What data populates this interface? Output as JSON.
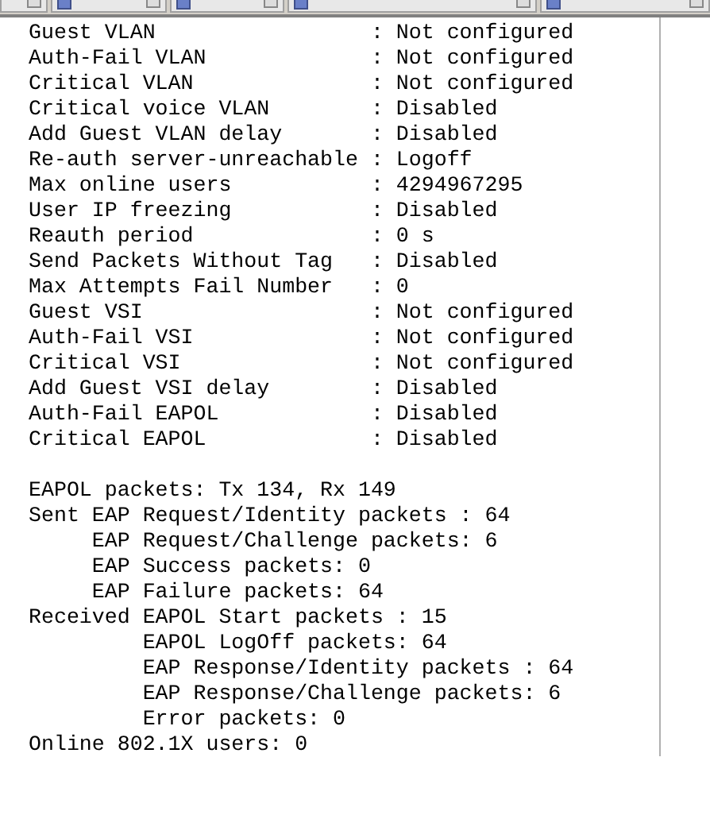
{
  "tabs": [
    {
      "selected": false
    },
    {
      "selected": false
    },
    {
      "selected": false
    },
    {
      "selected": false
    },
    {
      "selected": false
    }
  ],
  "sections": [
    {
      "lines": [
        "Guest VLAN                 : Not configured",
        "Auth-Fail VLAN             : Not configured",
        "Critical VLAN              : Not configured",
        "Critical voice VLAN        : Disabled",
        "Add Guest VLAN delay       : Disabled",
        "Re-auth server-unreachable : Logoff",
        "Max online users           : 4294967295",
        "User IP freezing           : Disabled",
        "Reauth period              : 0 s",
        "Send Packets Without Tag   : Disabled",
        "Max Attempts Fail Number   : 0",
        "Guest VSI                  : Not configured",
        "Auth-Fail VSI              : Not configured",
        "Critical VSI               : Not configured",
        "Add Guest VSI delay        : Disabled",
        "Auth-Fail EAPOL            : Disabled",
        "Critical EAPOL             : Disabled"
      ]
    },
    {
      "lines": [
        "EAPOL packets: Tx 134, Rx 149",
        "Sent EAP Request/Identity packets : 64",
        "     EAP Request/Challenge packets: 6",
        "     EAP Success packets: 0",
        "     EAP Failure packets: 64",
        "Received EAPOL Start packets : 15",
        "         EAPOL LogOff packets: 64",
        "         EAP Response/Identity packets : 64",
        "         EAP Response/Challenge packets: 6",
        "         Error packets: 0",
        "Online 802.1X users: 0"
      ]
    }
  ]
}
